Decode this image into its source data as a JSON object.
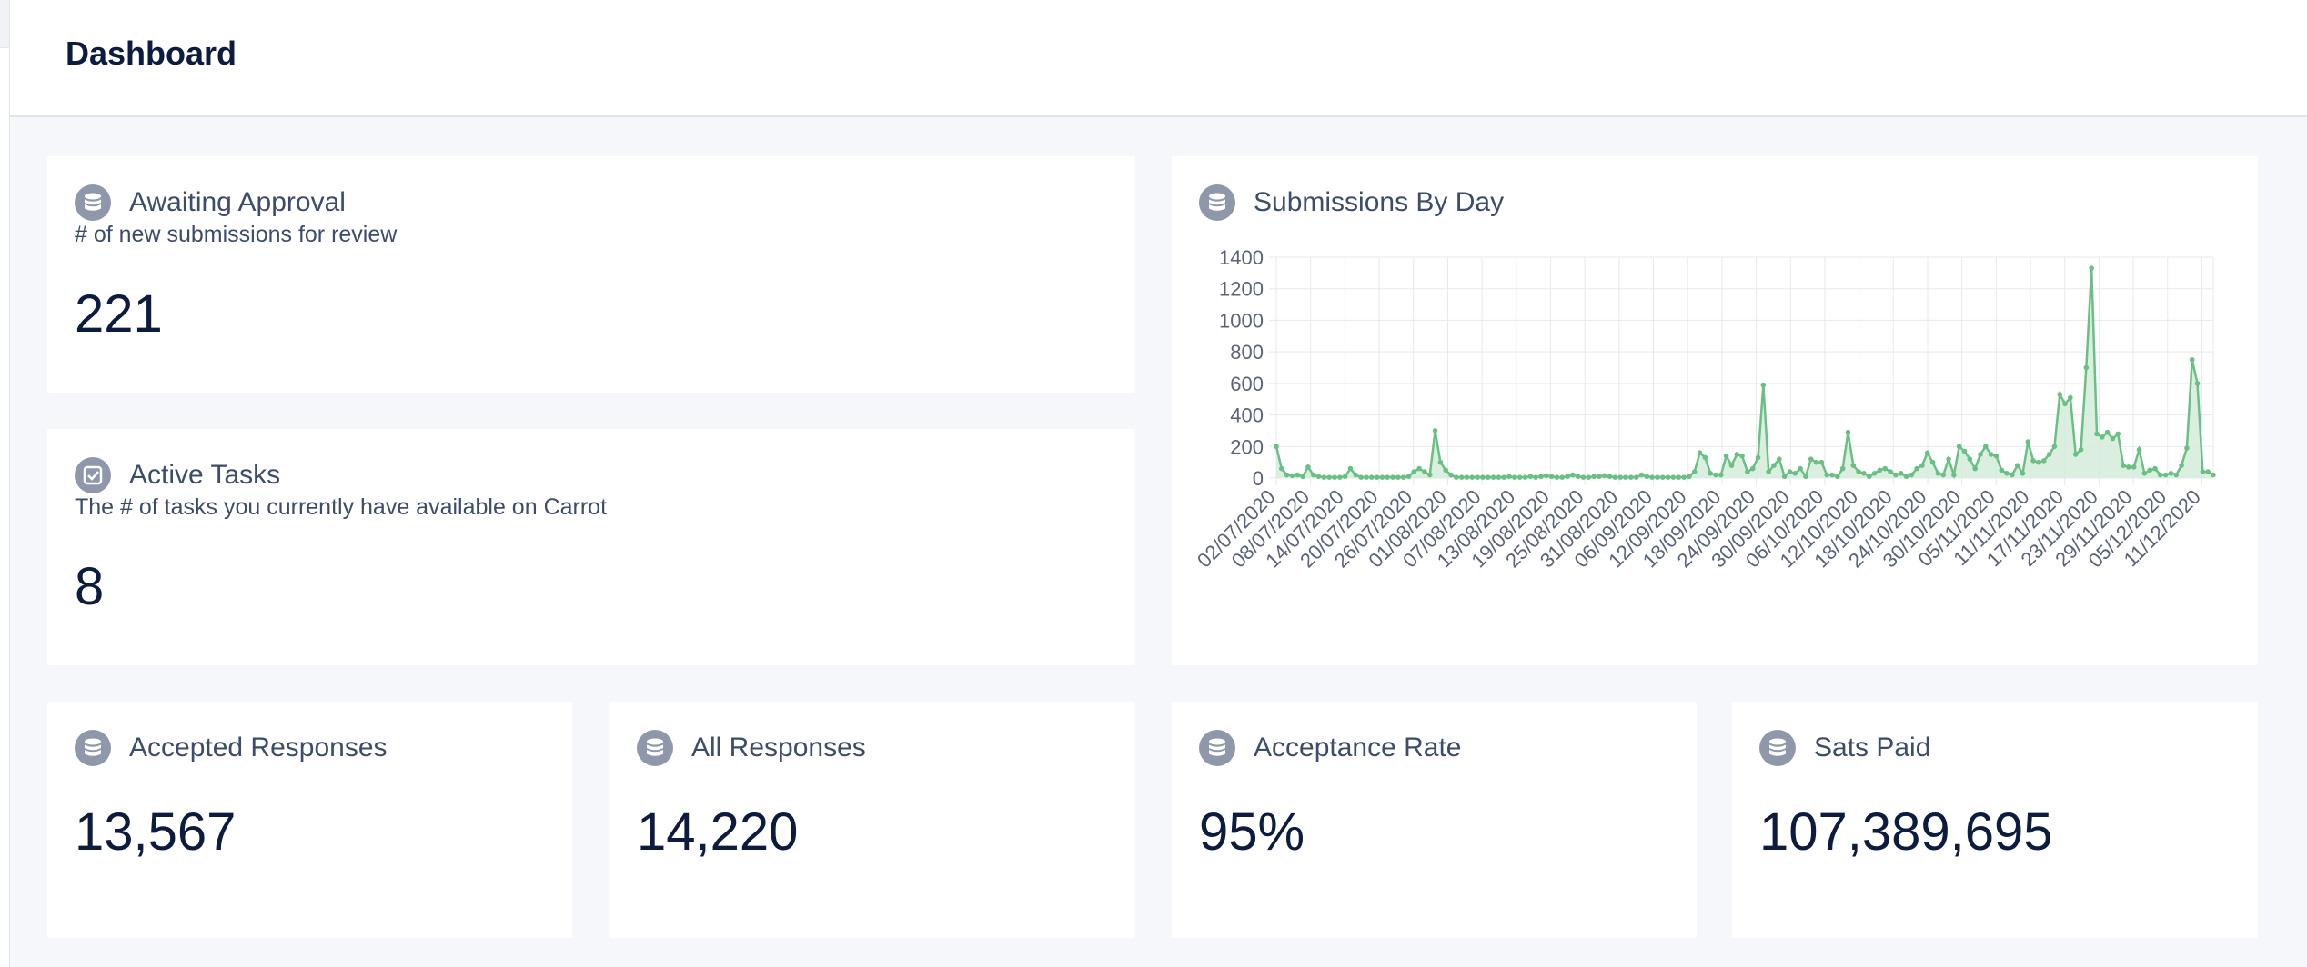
{
  "header": {
    "title": "Dashboard"
  },
  "cards": {
    "awaiting_approval": {
      "title": "Awaiting Approval",
      "subtitle": "# of new submissions for review",
      "value": "221",
      "icon": "database-icon"
    },
    "active_tasks": {
      "title": "Active Tasks",
      "subtitle": "The # of tasks you currently have available on Carrot",
      "value": "8",
      "icon": "checkbox-icon"
    },
    "accepted_responses": {
      "title": "Accepted Responses",
      "value": "13,567",
      "icon": "database-icon"
    },
    "all_responses": {
      "title": "All Responses",
      "value": "14,220",
      "icon": "database-icon"
    },
    "acceptance_rate": {
      "title": "Acceptance Rate",
      "value": "95%",
      "icon": "database-icon"
    },
    "sats_paid": {
      "title": "Sats Paid",
      "value": "107,389,695",
      "icon": "database-icon"
    },
    "submissions_by_day": {
      "title": "Submissions By Day",
      "icon": "database-icon"
    }
  },
  "colors": {
    "accent_line": "#6bbf85",
    "accent_fill": "#d3ecdb",
    "icon_bg": "#8f97ab",
    "title_text": "#3e4c6b",
    "value_text": "#0d1b3e"
  },
  "chart_data": {
    "type": "area",
    "title": "Submissions By Day",
    "xlabel": "",
    "ylabel": "",
    "ylim": [
      0,
      1400
    ],
    "yticks": [
      0,
      200,
      400,
      600,
      800,
      1000,
      1200,
      1400
    ],
    "grid": true,
    "legend": "none",
    "x_tick_labels": [
      "02/07/2020",
      "08/07/2020",
      "14/07/2020",
      "20/07/2020",
      "26/07/2020",
      "01/08/2020",
      "07/08/2020",
      "13/08/2020",
      "19/08/2020",
      "25/08/2020",
      "31/08/2020",
      "06/09/2020",
      "12/09/2020",
      "18/09/2020",
      "24/09/2020",
      "30/09/2020",
      "06/10/2020",
      "12/10/2020",
      "18/10/2020",
      "24/10/2020",
      "30/10/2020",
      "05/11/2020",
      "11/11/2020",
      "17/11/2020",
      "23/11/2020",
      "29/11/2020",
      "05/12/2020",
      "11/12/2020"
    ],
    "x_start": "02/07/2020",
    "x_end": "14/12/2020",
    "values": [
      200,
      60,
      20,
      15,
      20,
      10,
      70,
      20,
      10,
      5,
      5,
      5,
      5,
      10,
      60,
      20,
      5,
      5,
      5,
      5,
      5,
      5,
      5,
      5,
      5,
      10,
      40,
      60,
      40,
      20,
      300,
      100,
      50,
      20,
      5,
      5,
      5,
      5,
      5,
      5,
      5,
      5,
      5,
      5,
      10,
      5,
      5,
      5,
      10,
      5,
      10,
      15,
      10,
      5,
      5,
      10,
      20,
      10,
      5,
      5,
      10,
      10,
      15,
      10,
      5,
      5,
      5,
      5,
      5,
      20,
      10,
      5,
      5,
      5,
      5,
      5,
      5,
      5,
      10,
      40,
      160,
      130,
      30,
      20,
      20,
      140,
      80,
      150,
      140,
      40,
      60,
      130,
      590,
      40,
      80,
      120,
      10,
      40,
      30,
      60,
      10,
      120,
      100,
      100,
      20,
      20,
      10,
      60,
      290,
      80,
      40,
      30,
      10,
      30,
      50,
      60,
      40,
      20,
      30,
      10,
      20,
      60,
      80,
      160,
      100,
      30,
      20,
      120,
      20,
      200,
      170,
      120,
      60,
      150,
      200,
      150,
      140,
      50,
      30,
      20,
      80,
      30,
      230,
      110,
      100,
      110,
      150,
      200,
      530,
      470,
      510,
      150,
      180,
      700,
      1330,
      280,
      260,
      290,
      250,
      280,
      80,
      70,
      70,
      180,
      30,
      50,
      60,
      20,
      20,
      30,
      20,
      80,
      190,
      750,
      600,
      40,
      40,
      20
    ]
  }
}
